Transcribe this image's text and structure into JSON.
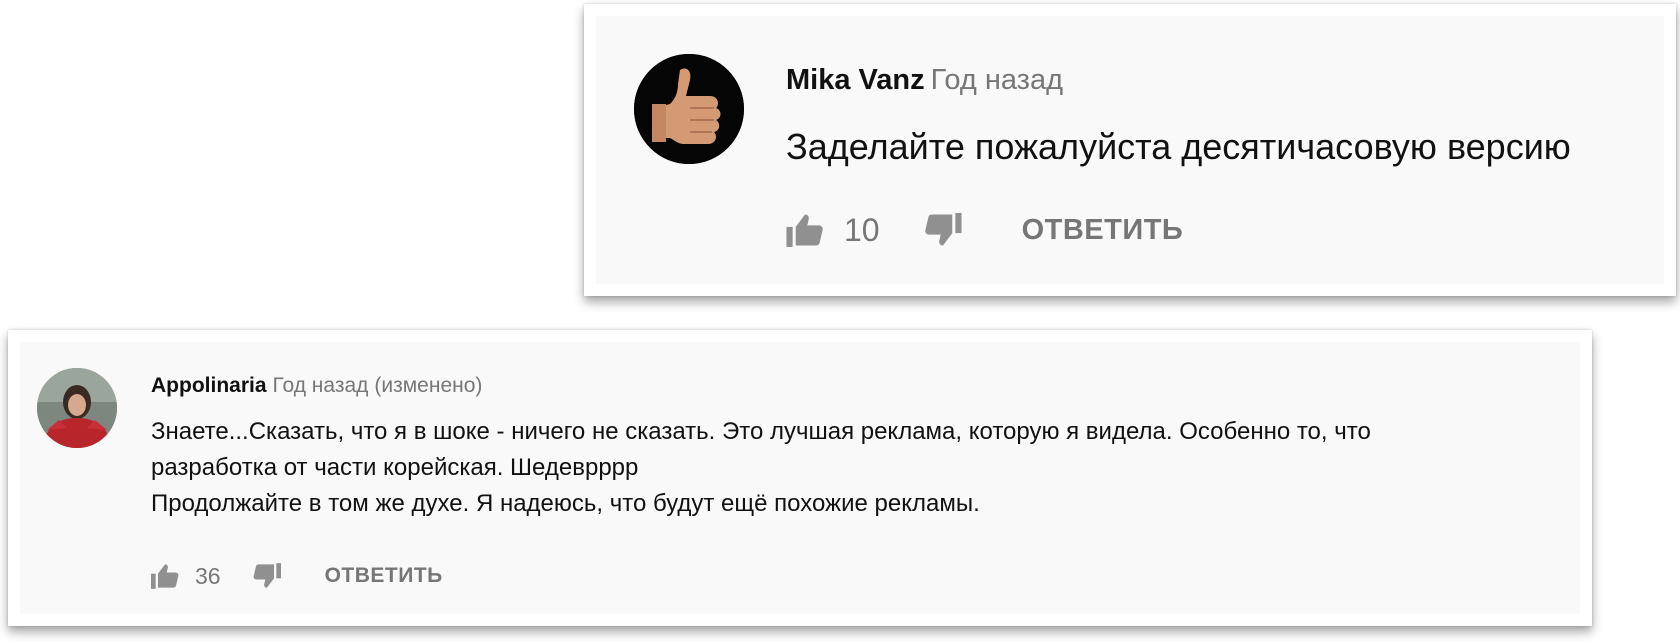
{
  "comments": [
    {
      "author": "Mika Vanz",
      "time": "Год назад",
      "edited": "",
      "text_lines": [
        "Заделайте пожалуйста десятичасовую версию"
      ],
      "likes": "10",
      "reply_label": "ОТВЕТИТЬ",
      "avatar_icon": "thumbs-up-avatar"
    },
    {
      "author": "Appolinaria",
      "time": "Год назад",
      "edited": "(изменено)",
      "text_lines": [
        "Знаете...Сказать, что я в шоке - ничего не сказать. Это лучшая реклама, которую я видела. Особенно то, что",
        "разработка от части корейская. Шедеврррр",
        "Продолжайте в том же духе. Я надеюсь, что будут ещё похожие рекламы."
      ],
      "likes": "36",
      "reply_label": "ОТВЕТИТЬ",
      "avatar_icon": "user-photo-avatar"
    }
  ],
  "colors": {
    "card_background": "#f9f9f9",
    "author": "#111111",
    "secondary_text": "#767676",
    "icon": "#909090"
  }
}
